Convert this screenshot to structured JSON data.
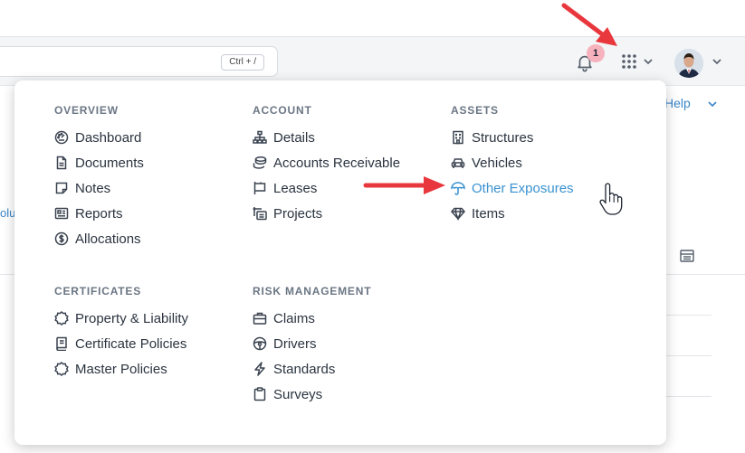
{
  "search": {
    "shortcut": "Ctrl + /"
  },
  "notifications": {
    "count": "1"
  },
  "help": {
    "label": "Help"
  },
  "side_text": "olu",
  "menu": {
    "overview": {
      "title": "OVERVIEW",
      "items": [
        {
          "label": "Dashboard",
          "icon": "dashboard-icon"
        },
        {
          "label": "Documents",
          "icon": "document-icon"
        },
        {
          "label": "Notes",
          "icon": "note-icon"
        },
        {
          "label": "Reports",
          "icon": "report-icon"
        },
        {
          "label": "Allocations",
          "icon": "dollar-icon"
        }
      ]
    },
    "account": {
      "title": "ACCOUNT",
      "items": [
        {
          "label": "Details",
          "icon": "sitemap-icon"
        },
        {
          "label": "Accounts Receivable",
          "icon": "coins-icon"
        },
        {
          "label": "Leases",
          "icon": "lease-icon"
        },
        {
          "label": "Projects",
          "icon": "projects-icon"
        }
      ]
    },
    "assets": {
      "title": "ASSETS",
      "items": [
        {
          "label": "Structures",
          "icon": "building-icon"
        },
        {
          "label": "Vehicles",
          "icon": "car-icon"
        },
        {
          "label": "Other Exposures",
          "icon": "umbrella-icon",
          "active": true
        },
        {
          "label": "Items",
          "icon": "diamond-icon"
        }
      ]
    },
    "certificates": {
      "title": "CERTIFICATES",
      "items": [
        {
          "label": "Property & Liability",
          "icon": "certificate-icon"
        },
        {
          "label": "Certificate Policies",
          "icon": "policy-book-icon"
        },
        {
          "label": "Master Policies",
          "icon": "certificate-icon"
        }
      ]
    },
    "risk": {
      "title": "RISK MANAGEMENT",
      "items": [
        {
          "label": "Claims",
          "icon": "briefcase-icon"
        },
        {
          "label": "Drivers",
          "icon": "steering-wheel-icon"
        },
        {
          "label": "Standards",
          "icon": "bolt-icon"
        },
        {
          "label": "Surveys",
          "icon": "clipboard-icon"
        }
      ]
    }
  },
  "colors": {
    "accent": "#3a92d0",
    "arrow": "#e8373d",
    "badge": "#f6b3bd"
  }
}
